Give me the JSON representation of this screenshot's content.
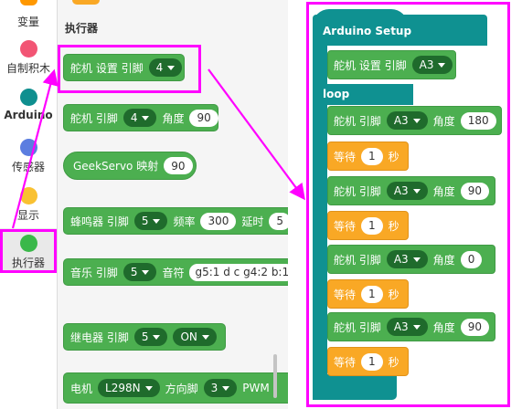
{
  "sidebar": {
    "categories": [
      {
        "label": "变量",
        "color": "#ff9800"
      },
      {
        "label": "自制积木",
        "color": "#f25574"
      },
      {
        "label": "Arduino",
        "color": "#0f8f8f"
      },
      {
        "label": "传感器",
        "color": "#5b7de0"
      },
      {
        "label": "显示",
        "color": "#f9c132"
      },
      {
        "label": "执行器",
        "color": "#3ab84a"
      }
    ]
  },
  "palette": {
    "title": "执行器",
    "servo_setup": {
      "label": "舵机 设置 引脚",
      "pin": "4"
    },
    "servo_pin": {
      "label": "舵机 引脚",
      "pin": "4",
      "angle_label": "角度",
      "angle": "90"
    },
    "geekservo": {
      "label": "GeekServo 映射",
      "value": "90"
    },
    "buzzer": {
      "label": "蜂鸣器 引脚",
      "pin": "5",
      "freq_label": "频率",
      "freq": "300",
      "delay_label": "延时",
      "delay": "5"
    },
    "music": {
      "label": "音乐 引脚",
      "pin": "5",
      "notes_label": "音符",
      "notes": "g5:1 d c g4:2 b:1"
    },
    "relay": {
      "label": "继电器 引脚",
      "pin": "5",
      "state": "ON"
    },
    "motor": {
      "label": "电机",
      "driver": "L298N",
      "dir_label": "方向脚",
      "dir_pin": "3",
      "pwm_label": "PWM"
    }
  },
  "workspace": {
    "setup_label": "Arduino Setup",
    "loop_label": "loop",
    "setup_block": {
      "label": "舵机 设置 引脚",
      "pin": "A3"
    },
    "steps": [
      {
        "servo_label": "舵机 引脚",
        "pin": "A3",
        "angle_label": "角度",
        "angle": "180",
        "wait_label": "等待",
        "wait": "1",
        "unit": "秒"
      },
      {
        "servo_label": "舵机 引脚",
        "pin": "A3",
        "angle_label": "角度",
        "angle": "90",
        "wait_label": "等待",
        "wait": "1",
        "unit": "秒"
      },
      {
        "servo_label": "舵机 引脚",
        "pin": "A3",
        "angle_label": "角度",
        "angle": "0",
        "wait_label": "等待",
        "wait": "1",
        "unit": "秒"
      },
      {
        "servo_label": "舵机 引脚",
        "pin": "A3",
        "angle_label": "角度",
        "angle": "90",
        "wait_label": "等待",
        "wait": "1",
        "unit": "秒"
      }
    ]
  },
  "colors": {
    "highlight": "#ff00ff",
    "block_green": "#4caf50",
    "wait_orange": "#f9a825",
    "hat_teal": "#0f9191"
  }
}
